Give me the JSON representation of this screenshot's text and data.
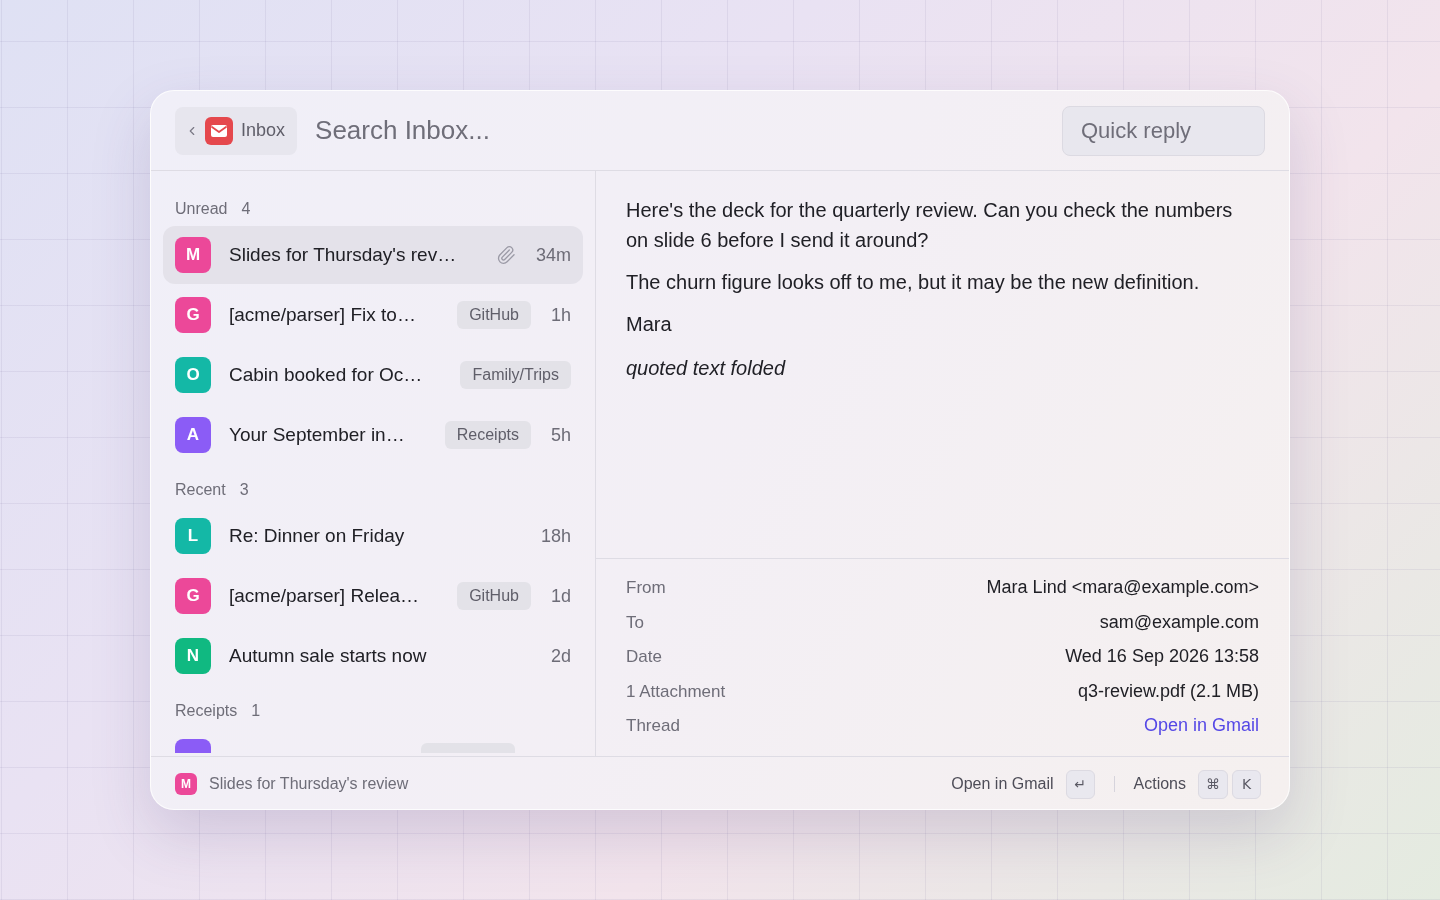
{
  "header": {
    "back_button": {
      "label": "Inbox"
    },
    "search": {
      "placeholder": "Search Inbox..."
    },
    "quick_reply": {
      "placeholder": "Quick reply"
    }
  },
  "sections": [
    {
      "title": "Unread",
      "count": "4",
      "items": [
        {
          "kind": "message",
          "letter": "M",
          "color": "#ec4899",
          "subject": "Slides for Thursday's rev…",
          "attachment": true,
          "time": "34m",
          "selected": true
        },
        {
          "kind": "message",
          "letter": "G",
          "color": "#ec4899",
          "subject": "[acme/parser] Fix to…",
          "attachment": false,
          "tag": "GitHub",
          "time": "1h",
          "selected": false
        },
        {
          "kind": "message",
          "letter": "O",
          "color": "#14b8a6",
          "subject": "Cabin booked for Oc…",
          "attachment": false,
          "tag": "Family/Trips",
          "selected": false
        },
        {
          "kind": "message",
          "letter": "A",
          "color": "#8b5cf6",
          "subject": "Your September in…",
          "attachment": false,
          "tag": "Receipts",
          "time": "5h",
          "selected": false
        }
      ]
    },
    {
      "title": "Recent",
      "count": "3",
      "items": [
        {
          "kind": "message",
          "letter": "L",
          "color": "#14b8a6",
          "subject": "Re: Dinner on Friday",
          "attachment": false,
          "time": "18h",
          "selected": false
        },
        {
          "kind": "message",
          "letter": "G",
          "color": "#ec4899",
          "subject": "[acme/parser] Relea…",
          "attachment": false,
          "tag": "GitHub",
          "time": "1d",
          "selected": false
        },
        {
          "kind": "message",
          "letter": "N",
          "color": "#10b981",
          "subject": "Autumn sale starts now",
          "attachment": false,
          "time": "2d",
          "selected": false
        }
      ]
    },
    {
      "title": "Receipts",
      "count": "1",
      "items": [
        {
          "kind": "clipped",
          "color": "#8b5cf6",
          "tag_visible": true,
          "selected": false
        }
      ]
    }
  ],
  "message": {
    "paragraphs": [
      "Here's the deck for the quarterly review. Can you check the numbers on slide 6 before I send it around?",
      "The churn figure looks off to me, but it may be the new definition.",
      "Mara"
    ],
    "folded_note": "quoted text folded"
  },
  "details": [
    {
      "kind": "text",
      "label": "From",
      "value": "Mara Lind <mara@example.com>"
    },
    {
      "kind": "text",
      "label": "To",
      "value": "sam@example.com"
    },
    {
      "kind": "text",
      "label": "Date",
      "value": "Wed 16 Sep 2026 13:58"
    },
    {
      "kind": "text",
      "label": "1 Attachment",
      "value": "q3-review.pdf (2.1 MB)"
    },
    {
      "kind": "link",
      "label": "Thread",
      "value": "Open in Gmail"
    }
  ],
  "status_bar": {
    "avatar": {
      "letter": "M",
      "color": "#ec4899"
    },
    "subject": "Slides for Thursday's review",
    "actions": [
      {
        "label": "Open in Gmail",
        "keys": [
          "↵"
        ]
      },
      {
        "label": "Actions",
        "keys": [
          "⌘",
          "K"
        ]
      }
    ]
  }
}
